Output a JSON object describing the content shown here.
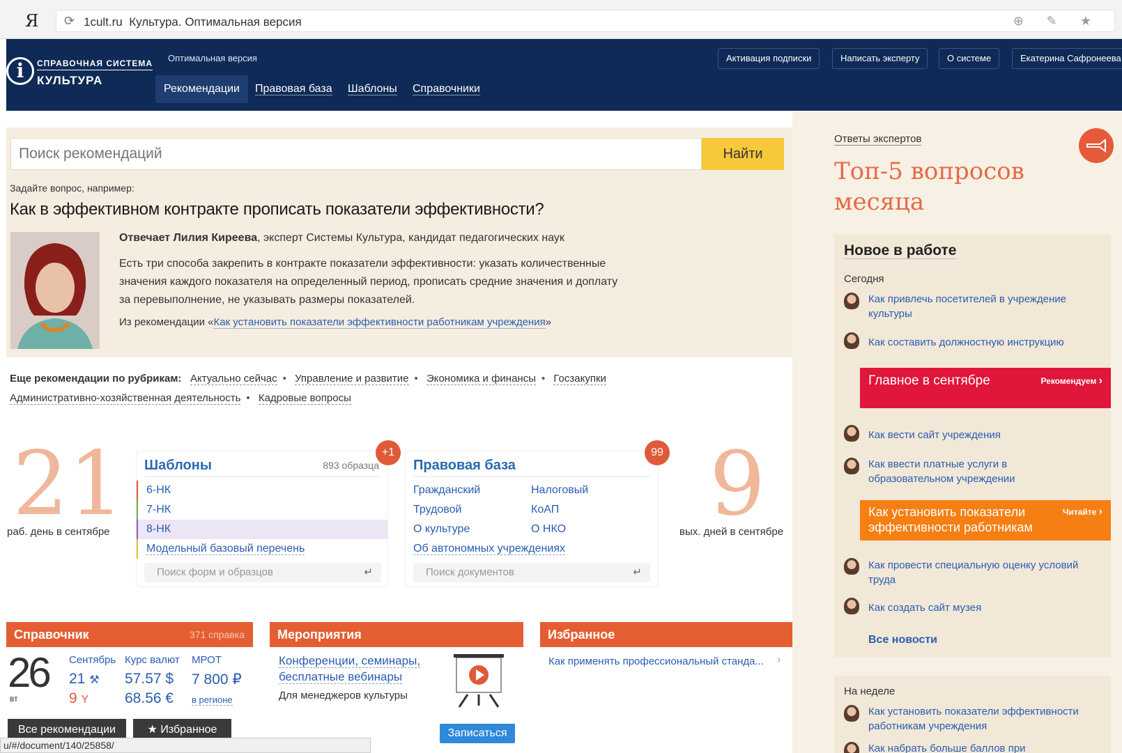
{
  "browser": {
    "logo": "Я",
    "reload_icon": "reload-icon",
    "url_domain": "1cult.ru",
    "url_title": "Культура. Оптимальная версия",
    "icons": "⊕ ✎ ★"
  },
  "header": {
    "logo_small": "СПРАВОЧНАЯ СИСТЕМА",
    "logo_big": "КУЛЬТУРА",
    "version": "Оптимальная версия",
    "nav": [
      "Рекомендации",
      "Правовая база",
      "Шаблоны",
      "Справочники"
    ],
    "buttons": [
      "Активация подписки",
      "Написать эксперту",
      "О системе",
      "Екатерина Сафронеева"
    ]
  },
  "search": {
    "placeholder": "Поиск рекомендаций",
    "button": "Найти"
  },
  "qa": {
    "ask_label": "Задайте вопрос, например:",
    "question": "Как в эффективном контракте прописать показатели эффективности?",
    "expert_name": "Отвечает Лилия Киреева",
    "expert_desc": ", эксперт Системы Культура, кандидат педагогических наук",
    "answer_1": "Есть три способа закрепить в контракте показатели эффективности: указать количественные",
    "answer_2": "значения каждого показателя на определенный период, прописать средние значения и доплату",
    "answer_3": "за перевыполнение, не указывать размеры показателей.",
    "from_prefix": "Из рекомендации «",
    "from_link": "Как установить показатели эффективности работникам учреждения",
    "from_suffix": "»"
  },
  "rubrics": {
    "label": "Еще рекомендации по рубрикам:",
    "line1": [
      "Актуально сейчас",
      "Управление и развитие",
      "Экономика и финансы",
      "Госзакупки"
    ],
    "line2": [
      "Административно-хозяйственная деятельность",
      "Кадровые вопросы"
    ],
    "bullet": "•"
  },
  "workdays": {
    "num": "21",
    "caption": "раб. день в сентябре"
  },
  "holidays": {
    "num": "9",
    "caption": "вых. дней в сентябре"
  },
  "templates": {
    "title": "Шаблоны",
    "count": "893 образца",
    "badge": "+1",
    "items": [
      {
        "label": "6-НК",
        "color": "#e05a3a"
      },
      {
        "label": "7-НК",
        "color": "#6fb33e"
      },
      {
        "label": "8-НК",
        "color": "#8a5cc4"
      },
      {
        "label": "Модельный базовый перечень",
        "color": "#f2b83a"
      }
    ],
    "search_placeholder": "Поиск форм и образцов"
  },
  "legal": {
    "title": "Правовая база",
    "badge": "99",
    "col1": [
      "Гражданский",
      "Трудовой",
      "О культуре",
      "Об автономных учреждениях"
    ],
    "col2": [
      "Налоговый",
      "КоАП",
      "О НКО"
    ],
    "search_placeholder": "Поиск документов"
  },
  "reference": {
    "title": "Справочник",
    "count": "371 справка",
    "day": "26",
    "weekday": "вт",
    "col_month": "Сентябрь",
    "col_rate": "Курс валют",
    "col_mrot": "МРОТ",
    "workdays_val": "21",
    "holidays_val": "9",
    "usd": "57.57 $",
    "eur": "68.56 €",
    "mrot_val": "7 800 ₽",
    "mrot_note": "в регионе"
  },
  "events": {
    "title": "Мероприятия",
    "link": "Конференции, семинары, бесплатные вебинары",
    "desc": "Для менеджеров культуры",
    "button": "Записаться"
  },
  "favorites": {
    "title": "Избранное",
    "item": "Как применять профессиональный станда..."
  },
  "bottom_buttons": {
    "all": "Все рекомендации",
    "fav": "Избранное"
  },
  "status_url": "u/#/document/140/25858/",
  "right": {
    "experts_link": "Ответы экспертов",
    "top5_line1": "Топ-5 вопросов",
    "top5_line2": "месяца",
    "news_title": "Новое в работе",
    "today": "Сегодня",
    "items": [
      "Как привлечь посетителей в учреждение культуры",
      "Как составить должностную инструкцию",
      "Как вести сайт учреждения",
      "Как ввести платные услуги в образовательном учреждении",
      "Как провести специальную оценку условий труда",
      "Как создать сайт музея"
    ],
    "highlight1": {
      "text": "Главное в сентябре",
      "tag": "Рекомендуем"
    },
    "highlight2": {
      "text": "Как установить показатели эффективности работникам",
      "tag": "Читайте"
    },
    "all_news": "Все новости",
    "week": "На неделе",
    "week_items": [
      "Как установить показатели эффективности работникам учреждения",
      "Как набрать больше баллов при"
    ]
  },
  "colors": {
    "header": "#0f2a57",
    "accent": "#e45e32",
    "search_btn": "#f7c93a",
    "beige": "#f5ede0"
  }
}
